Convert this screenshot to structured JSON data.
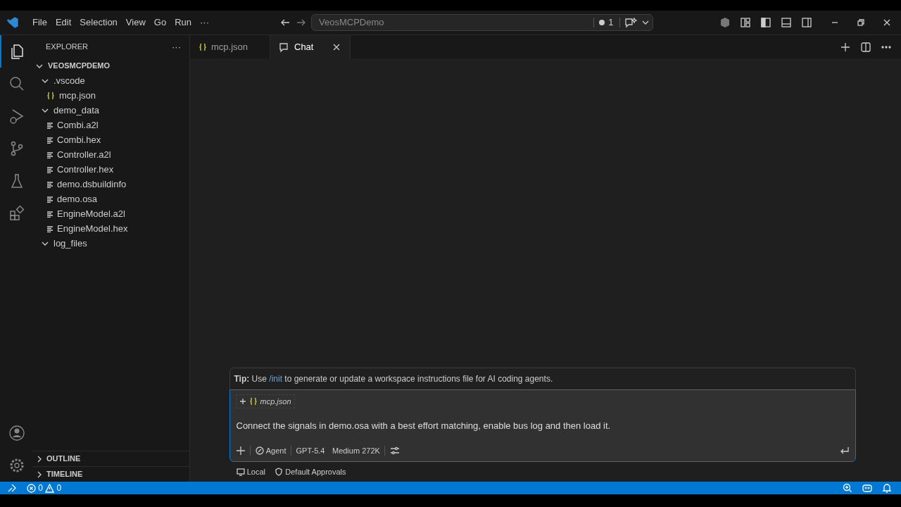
{
  "menu": [
    "File",
    "Edit",
    "Selection",
    "View",
    "Go",
    "Run",
    "···"
  ],
  "command_center": {
    "text": "VeosMCPDemo",
    "badge": "1"
  },
  "activity_bar": [
    {
      "kind": "files",
      "selected": true
    },
    {
      "kind": "search",
      "selected": false
    },
    {
      "kind": "debug",
      "selected": false
    },
    {
      "kind": "branch",
      "selected": false
    },
    {
      "kind": "flask",
      "selected": false
    },
    {
      "kind": "blocks",
      "selected": false
    }
  ],
  "sidebar": {
    "title": "EXPLORER",
    "more": "···",
    "tree": {
      "label": "VEOSMCPDEMO",
      "kind": "folder",
      "expanded": true,
      "children": [
        {
          "label": ".vscode",
          "kind": "folder",
          "expanded": true,
          "children": [
            {
              "label": "mcp.json",
              "kind": "json"
            }
          ]
        },
        {
          "label": "demo_data",
          "kind": "folder",
          "expanded": true,
          "children": [
            {
              "label": "Combi.a2l",
              "kind": "file"
            },
            {
              "label": "Combi.hex",
              "kind": "file"
            },
            {
              "label": "Controller.a2l",
              "kind": "file"
            },
            {
              "label": "Controller.hex",
              "kind": "file"
            },
            {
              "label": "demo.dsbuildinfo",
              "kind": "file"
            },
            {
              "label": "demo.osa",
              "kind": "file"
            },
            {
              "label": "EngineModel.a2l",
              "kind": "file"
            },
            {
              "label": "EngineModel.hex",
              "kind": "file"
            }
          ]
        },
        {
          "label": "log_files",
          "kind": "folder",
          "expanded": true
        }
      ]
    },
    "panels": [
      {
        "label": "OUTLINE",
        "expanded": false
      },
      {
        "label": "TIMELINE",
        "expanded": false
      }
    ]
  },
  "tabs": [
    {
      "label": "mcp.json",
      "kind": "json",
      "selected": false
    },
    {
      "label": "Chat",
      "kind": "chat",
      "selected": true
    }
  ],
  "chat": {
    "tip_label": "Tip:",
    "tip_before": "Use",
    "tip_link": "/init",
    "tip_after": "to generate or update a workspace instructions file for AI coding agents.",
    "attachment": "mcp.json",
    "prompt": "Connect the signals in demo.osa with a best effort matching, enable bus log and then load it.",
    "mode": "Agent",
    "model": "GPT-5.4",
    "effort": "Medium 272K",
    "footer": [
      "Local",
      "Default Approvals"
    ]
  },
  "status_bar": {
    "errors": "0",
    "warnings": "0"
  }
}
